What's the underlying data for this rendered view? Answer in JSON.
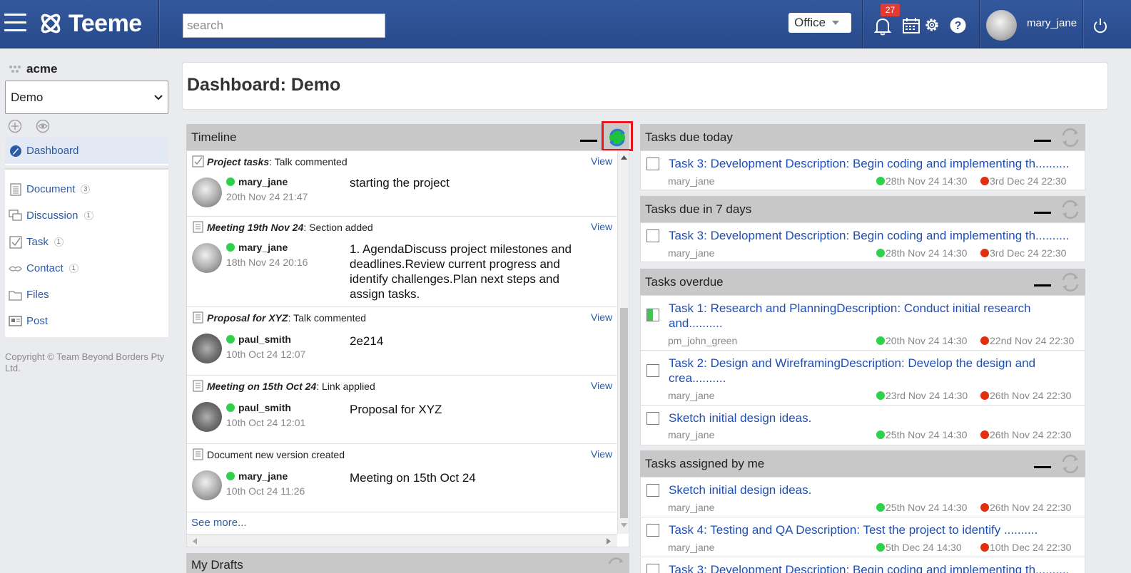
{
  "topbar": {
    "brand": "Teeme",
    "search_placeholder": "search",
    "office_label": "Office",
    "notifications_count": "27",
    "username": "mary_jane"
  },
  "sidebar": {
    "org": "acme",
    "dashboard_select": "Demo",
    "nav": [
      {
        "label": "Dashboard",
        "icon": "dashboard-icon",
        "active": true
      },
      {
        "label": "Document",
        "count": "3",
        "icon": "document-icon"
      },
      {
        "label": "Discussion",
        "count": "1",
        "icon": "discussion-icon"
      },
      {
        "label": "Task",
        "count": "1",
        "icon": "task-icon"
      },
      {
        "label": "Contact",
        "count": "1",
        "icon": "contact-icon"
      },
      {
        "label": "Files",
        "icon": "folder-icon"
      },
      {
        "label": "Post",
        "icon": "post-icon"
      }
    ],
    "copyright": "Copyright © Team Beyond Borders Pty Ltd."
  },
  "dashboard": {
    "title": "Dashboard: Demo"
  },
  "timeline": {
    "title": "Timeline",
    "view_label": "View",
    "see_more": "See more...",
    "items": [
      {
        "subject": "Project tasks",
        "action": ": Talk commented",
        "user": "mary_jane",
        "date": "20th Nov 24 21:47",
        "text": "starting the project"
      },
      {
        "subject": "Meeting 19th Nov 24",
        "action": ": Section added",
        "user": "mary_jane",
        "date": "18th Nov 24 20:16",
        "text": "1. AgendaDiscuss project milestones and deadlines.Review current progress and identify challenges.Plan next steps and assign tasks."
      },
      {
        "subject": "Proposal for XYZ",
        "action": ": Talk commented",
        "user": "paul_smith",
        "date": "10th Oct 24 12:07",
        "text": "2e214"
      },
      {
        "subject": "Meeting on 15th Oct 24",
        "action": ": Link applied",
        "user": "paul_smith",
        "date": "10th Oct 24 12:01",
        "text": "Proposal for XYZ"
      },
      {
        "subject": "",
        "action": "Document new version created",
        "user": "mary_jane",
        "date": "10th Oct 24 11:26",
        "text": "Meeting on 15th Oct 24"
      }
    ]
  },
  "drafts": {
    "title": "My Drafts"
  },
  "tasks_today": {
    "title": "Tasks due today",
    "items": [
      {
        "title": "Task 3: Development Description: Begin coding and implementing th..........",
        "user": "mary_jane",
        "start": "28th Nov 24 14:30",
        "end": "3rd Dec 24 22:30"
      }
    ]
  },
  "tasks_7days": {
    "title": "Tasks due in 7 days",
    "items": [
      {
        "title": "Task 3: Development Description: Begin coding and implementing th..........",
        "user": "mary_jane",
        "start": "28th Nov 24 14:30",
        "end": "3rd Dec 24 22:30"
      }
    ]
  },
  "tasks_overdue": {
    "title": "Tasks overdue",
    "items": [
      {
        "title": "Task 1: Research and PlanningDescription: Conduct initial research and..........",
        "user": "pm_john_green",
        "start": "20th Nov 24 14:30",
        "end": "22nd Nov 24 22:30"
      },
      {
        "title": "Task 2: Design and WireframingDescription: Develop the design and crea..........",
        "user": "mary_jane",
        "start": "23rd Nov 24 14:30",
        "end": "26th Nov 24 22:30"
      },
      {
        "title": "Sketch initial design ideas.",
        "user": "mary_jane",
        "start": "25th Nov 24 14:30",
        "end": "26th Nov 24 22:30"
      }
    ]
  },
  "tasks_assigned": {
    "title": "Tasks assigned by me",
    "items": [
      {
        "title": "Sketch initial design ideas.",
        "user": "mary_jane",
        "start": "25th Nov 24 14:30",
        "end": "26th Nov 24 22:30"
      },
      {
        "title": "Task 4: Testing and QA Description: Test the project to identify ..........",
        "user": "mary_jane",
        "start": "5th Dec 24 14:30",
        "end": "10th Dec 24 22:30"
      },
      {
        "title": "Task 3: Development Description: Begin coding and implementing th..........",
        "user": "",
        "start": "",
        "end": ""
      }
    ]
  },
  "colors": {
    "topbar": "#2d5195",
    "link": "#2c5aa6",
    "task_link": "#1f4fb3",
    "start_dot": "#2ed24a",
    "end_dot": "#e2300f",
    "highlight": "#e8141c"
  }
}
